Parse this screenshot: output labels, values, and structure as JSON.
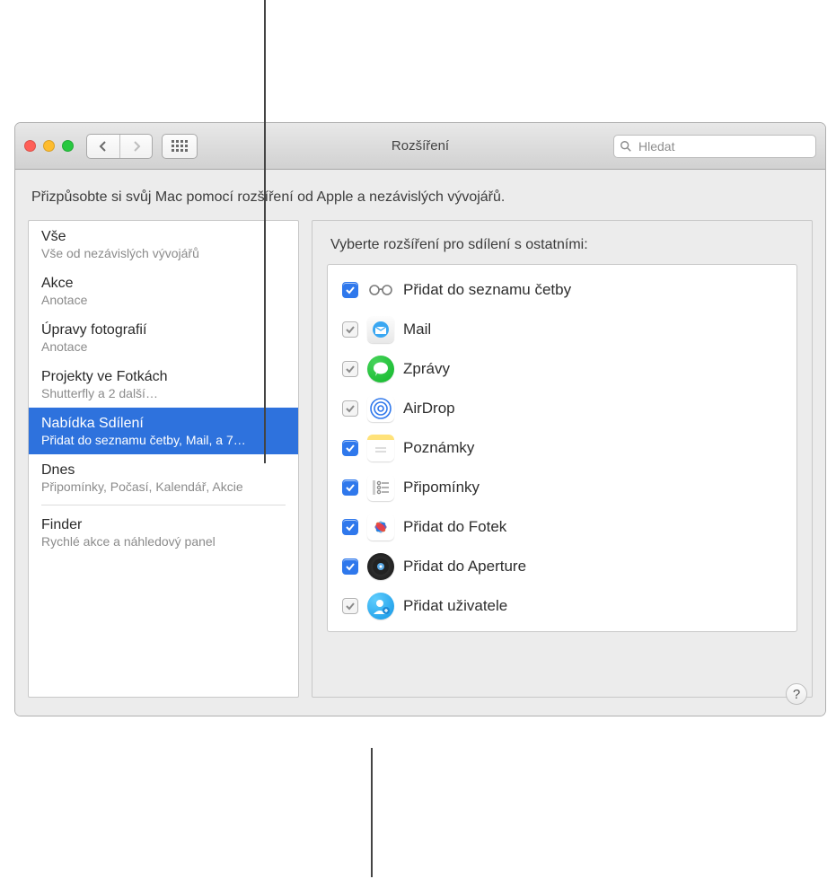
{
  "header": {
    "title": "Rozšíření",
    "search_placeholder": "Hledat"
  },
  "body": {
    "description": "Přizpůsobte si svůj Mac pomocí rozšíření od Apple a nezávislých vývojářů."
  },
  "sidebar": {
    "items": [
      {
        "title": "Vše",
        "subtitle": "Vše od nezávislých vývojářů",
        "selected": false
      },
      {
        "title": "Akce",
        "subtitle": "Anotace",
        "selected": false
      },
      {
        "title": "Úpravy fotografií",
        "subtitle": "Anotace",
        "selected": false
      },
      {
        "title": "Projekty ve Fotkách",
        "subtitle": "Shutterfly a 2 další…",
        "selected": false
      },
      {
        "title": "Nabídka Sdílení",
        "subtitle": "Přidat do seznamu četby, Mail, a 7…",
        "selected": true
      },
      {
        "title": "Dnes",
        "subtitle": "Připomínky, Počasí, Kalendář, Akcie",
        "selected": false
      },
      {
        "title": "Finder",
        "subtitle": "Rychlé akce a náhledový panel",
        "selected": false
      }
    ]
  },
  "panel": {
    "title": "Vyberte rozšíření pro sdílení s ostatními:",
    "extensions": [
      {
        "label": "Přidat do seznamu četby",
        "checked": true,
        "locked": false,
        "icon": "reading-list-icon"
      },
      {
        "label": "Mail",
        "checked": true,
        "locked": true,
        "icon": "mail-icon"
      },
      {
        "label": "Zprávy",
        "checked": true,
        "locked": true,
        "icon": "messages-icon"
      },
      {
        "label": "AirDrop",
        "checked": true,
        "locked": true,
        "icon": "airdrop-icon"
      },
      {
        "label": "Poznámky",
        "checked": true,
        "locked": false,
        "icon": "notes-icon"
      },
      {
        "label": "Připomínky",
        "checked": true,
        "locked": false,
        "icon": "reminders-icon"
      },
      {
        "label": "Přidat do Fotek",
        "checked": true,
        "locked": false,
        "icon": "photos-icon"
      },
      {
        "label": "Přidat do Aperture",
        "checked": true,
        "locked": false,
        "icon": "aperture-icon"
      },
      {
        "label": "Přidat uživatele",
        "checked": true,
        "locked": true,
        "icon": "add-user-icon"
      }
    ]
  },
  "colors": {
    "accent": "#2f78ec",
    "selection": "#2e72dd",
    "window_bg": "#ececec"
  }
}
